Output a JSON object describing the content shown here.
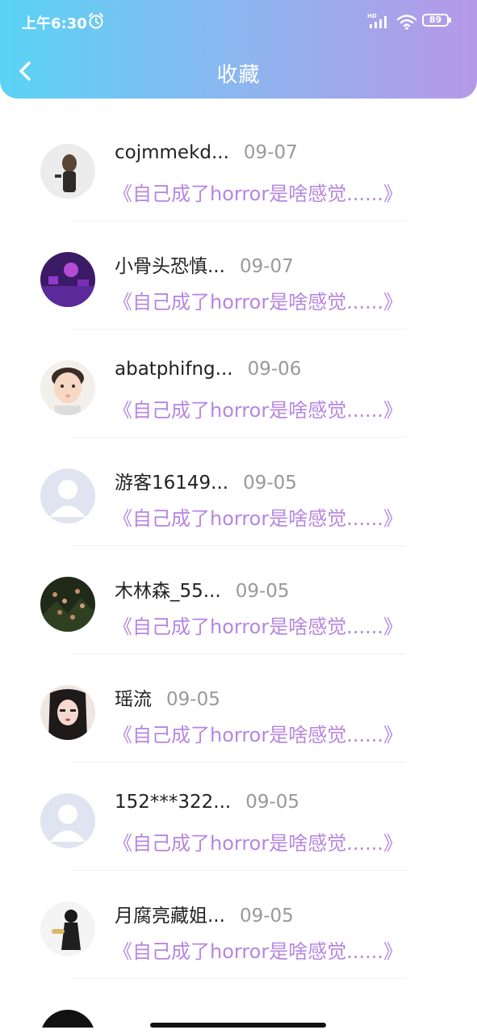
{
  "status_bar": {
    "time": "上午6:30",
    "battery": "89",
    "icons": [
      "alarm-icon",
      "signal-icon",
      "wifi-icon",
      "battery-icon"
    ]
  },
  "header": {
    "title": "收藏",
    "back_icon": "chevron-left-icon"
  },
  "favorites": [
    {
      "name": "cojmmekd...",
      "date": "09-07",
      "title": "《自己成了horror是啥感觉......》"
    },
    {
      "name": "小骨头恐慎...",
      "date": "09-07",
      "title": "《自己成了horror是啥感觉......》"
    },
    {
      "name": "abatphifng...",
      "date": "09-06",
      "title": "《自己成了horror是啥感觉......》"
    },
    {
      "name": "游客16149...",
      "date": "09-05",
      "title": "《自己成了horror是啥感觉......》"
    },
    {
      "name": "木林森_55...",
      "date": "09-05",
      "title": "《自己成了horror是啥感觉......》"
    },
    {
      "name": "瑶流",
      "date": "09-05",
      "title": "《自己成了horror是啥感觉......》"
    },
    {
      "name": "152***322...",
      "date": "09-05",
      "title": "《自己成了horror是啥感觉......》"
    },
    {
      "name": "月腐亮藏姐...",
      "date": "09-05",
      "title": "《自己成了horror是啥感觉......》"
    }
  ],
  "colors": {
    "header_gradient_start": "#5ad3f4",
    "header_gradient_end": "#b698e8",
    "title_accent": "#b786e0",
    "date_gray": "#999999"
  }
}
